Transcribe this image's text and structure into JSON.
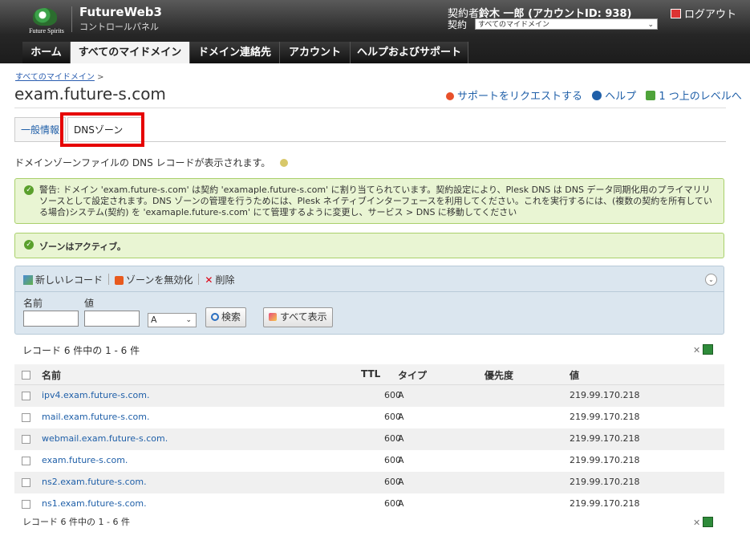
{
  "header": {
    "logo_text": "Future Spirits",
    "app_title": "FutureWeb3",
    "app_subtitle": "コントロールパネル",
    "owner_label": "契約者",
    "owner_name": "鈴木 一郎 (アカウントID: 938)",
    "subscription_label": "契約",
    "subscription_value": "すべてのマイドメイン",
    "logout": "ログアウト"
  },
  "main_tabs": [
    {
      "label": "ホーム"
    },
    {
      "label": "すべてのマイドメイン"
    },
    {
      "label": "ドメイン連絡先"
    },
    {
      "label": "アカウント"
    },
    {
      "label": "ヘルプおよびサポート"
    }
  ],
  "breadcrumb": {
    "link": "すべてのマイドメイン",
    "sep": ">"
  },
  "page_title": "exam.future-s.com",
  "tools": {
    "support": "サポートをリクエストする",
    "help": "ヘルプ",
    "up": "1 つ上のレベルへ"
  },
  "sub_tabs": [
    {
      "label": "一般情報"
    },
    {
      "label": "DNSゾーン"
    }
  ],
  "description": "ドメインゾーンファイルの DNS レコードが表示されます。",
  "warning": "警告: ドメイン 'exam.future-s.com' は契約 'examaple.future-s.com' に割り当てられています。契約設定により、Plesk DNS は DNS データ同期化用のプライマリリソースとして設定されます。DNS ゾーンの管理を行うためには、Plesk ネイティブインターフェースを利用してください。これを実行するには、(複数の契約を所有している場合)システム(契約) を 'examaple.future-s.com' にて管理するように変更し、サービス > DNS に移動してください",
  "active_message": "ゾーンはアクティブ。",
  "toolbar": {
    "new_record": "新しいレコード",
    "disable_zone": "ゾーンを無効化",
    "delete": "削除"
  },
  "search": {
    "name_label": "名前",
    "value_label": "値",
    "type_value": "A",
    "search_button": "検索",
    "show_all_button": "すべて表示"
  },
  "count_text": "レコード 6 件中の 1 - 6 件",
  "table": {
    "columns": [
      "名前",
      "TTL",
      "タイプ",
      "優先度",
      "値"
    ],
    "rows": [
      {
        "name": "ipv4.exam.future-s.com.",
        "ttl": "600",
        "type": "A",
        "priority": "",
        "value": "219.99.170.218"
      },
      {
        "name": "mail.exam.future-s.com.",
        "ttl": "600",
        "type": "A",
        "priority": "",
        "value": "219.99.170.218"
      },
      {
        "name": "webmail.exam.future-s.com.",
        "ttl": "600",
        "type": "A",
        "priority": "",
        "value": "219.99.170.218"
      },
      {
        "name": "exam.future-s.com.",
        "ttl": "600",
        "type": "A",
        "priority": "",
        "value": "219.99.170.218"
      },
      {
        "name": "ns2.exam.future-s.com.",
        "ttl": "600",
        "type": "A",
        "priority": "",
        "value": "219.99.170.218"
      },
      {
        "name": "ns1.exam.future-s.com.",
        "ttl": "600",
        "type": "A",
        "priority": "",
        "value": "219.99.170.218"
      }
    ]
  },
  "colors": {
    "highlight": "#e60000",
    "link": "#1f5fa8",
    "success_bg": "#e9f5d3"
  }
}
